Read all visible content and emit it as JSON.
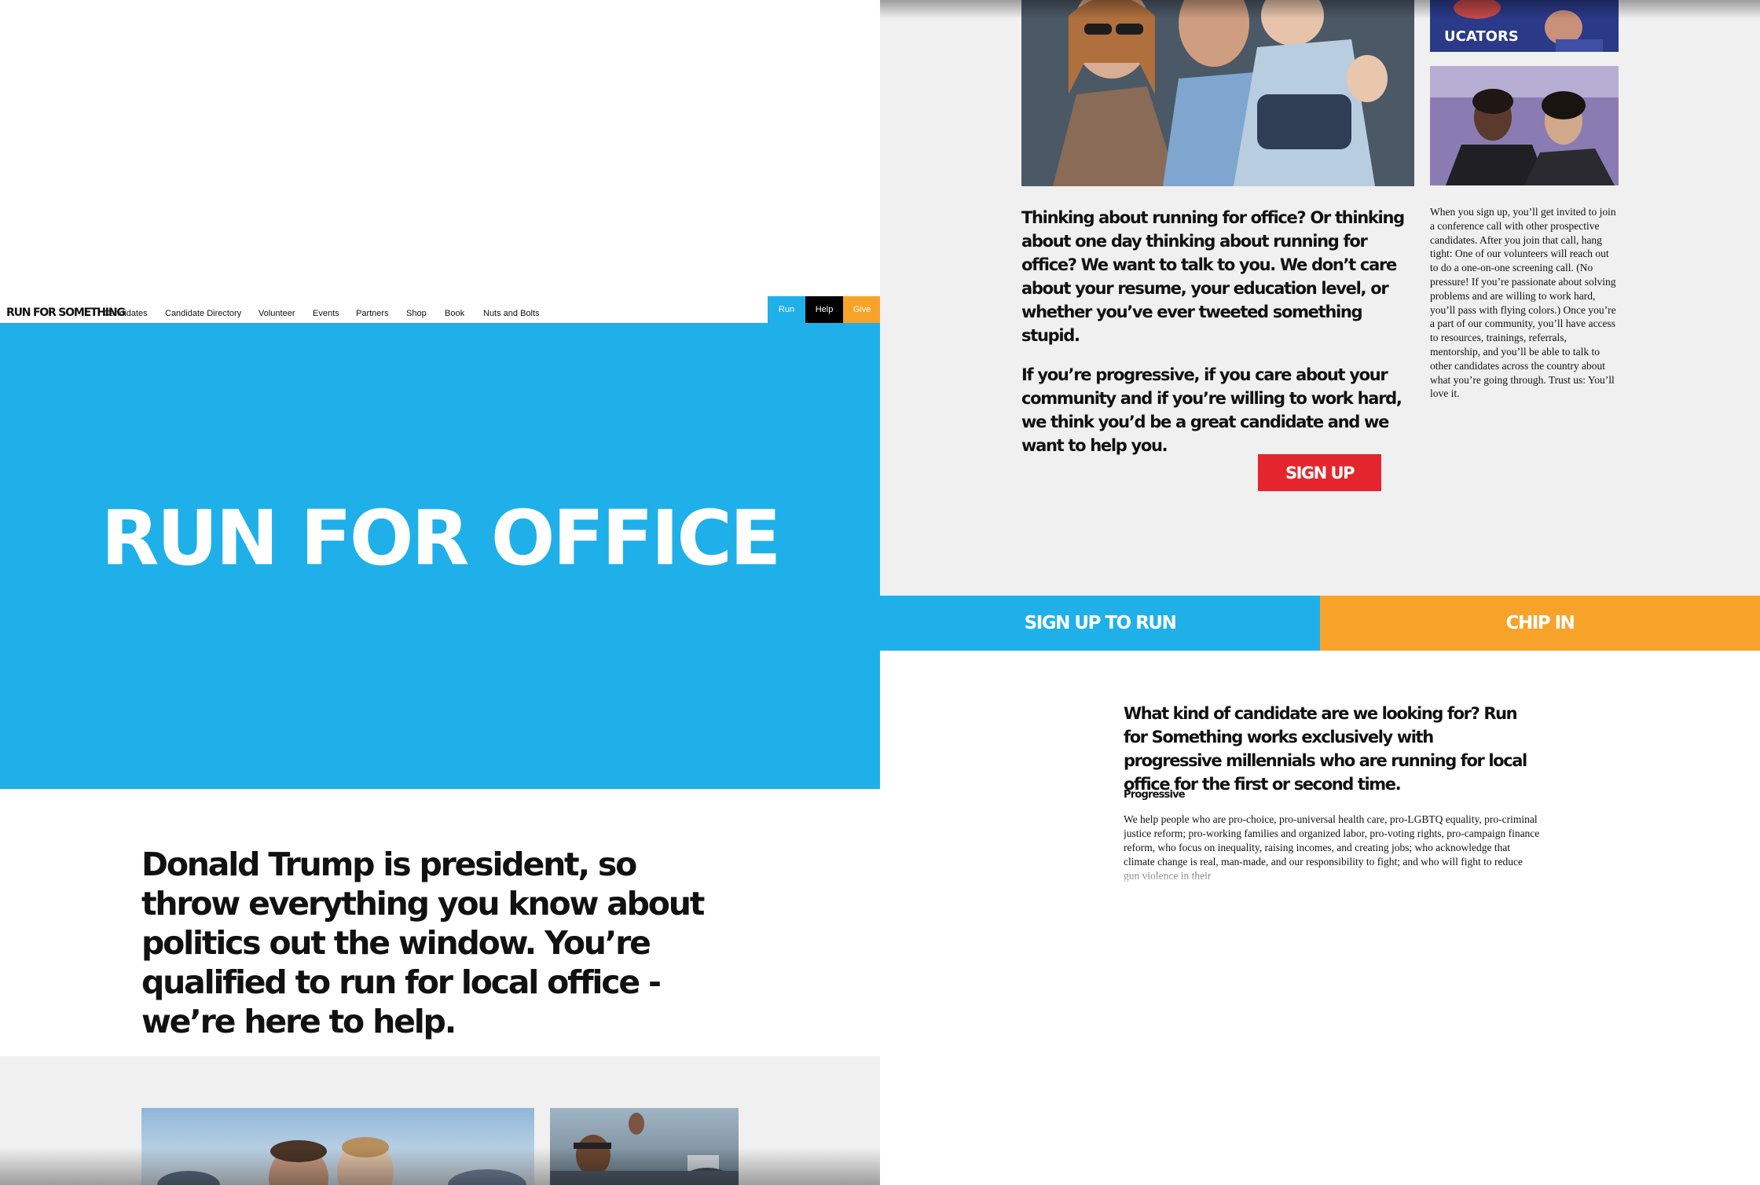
{
  "nav": {
    "logo": "RUN FOR SOMETHING",
    "links": [
      "Candidates",
      "Candidate Directory",
      "Volunteer",
      "Events",
      "Partners",
      "Shop",
      "Book",
      "Nuts and Bolts"
    ],
    "run": "Run",
    "help": "Help",
    "give": "Give"
  },
  "hero": {
    "title": "RUN FOR OFFICE"
  },
  "intro": {
    "text": "Donald Trump is president, so throw everything you know about politics out the window. You’re qualified to run for local office - we’re here to help."
  },
  "pitch": {
    "p1": "Thinking about running for office? Or thinking about one day thinking about running for office? We want to talk to you. We don’t care about your resume, your education level, or whether you’ve ever tweeted something stupid.",
    "p2": "If you’re progressive, if you care about your community and if you’re willing to work hard, we think you’d be a great candidate and we want to help you.",
    "side": "When you sign up, you’ll get invited to join a conference call with other prospective candidates. After you join that call, hang tight: One of our volunteers will reach out to do a one-on-one screening call. (No pressure! If you’re passionate about solving problems and are willing to work hard, you’ll pass with flying colors.) Once you’re a part of our community, you’ll have access to resources, trainings, referrals, mentorship, and you’ll be able to talk to other candidates across the country about what you’re going through. Trust us: You’ll love it.",
    "signup": "SIGN UP"
  },
  "cta": {
    "run": "SIGN UP TO RUN",
    "chip": "CHIP IN"
  },
  "looking": {
    "title": "What kind of candidate are we looking for? Run for Something works exclusively with progressive millennials who are running for local office for the first or second time.",
    "progressive_heading": "Progressive",
    "progressive_body": "We help people who are pro-choice, pro-universal health care, pro-LGBTQ equality, pro-criminal justice reform; pro-working families and organized labor, pro-voting rights, pro-campaign finance reform, who focus on inequality, raising incomes, and creating jobs; who acknowledge that climate change is real, man-made, and our responsibility to fight; and who will fight to reduce gun violence in their"
  },
  "photo_signs": {
    "sign_top": "UCATORS"
  },
  "colors": {
    "blue": "#1fb0e9",
    "orange": "#f7a32a",
    "red": "#e4252d",
    "black": "#000000",
    "gray": "#f0f0f0"
  }
}
